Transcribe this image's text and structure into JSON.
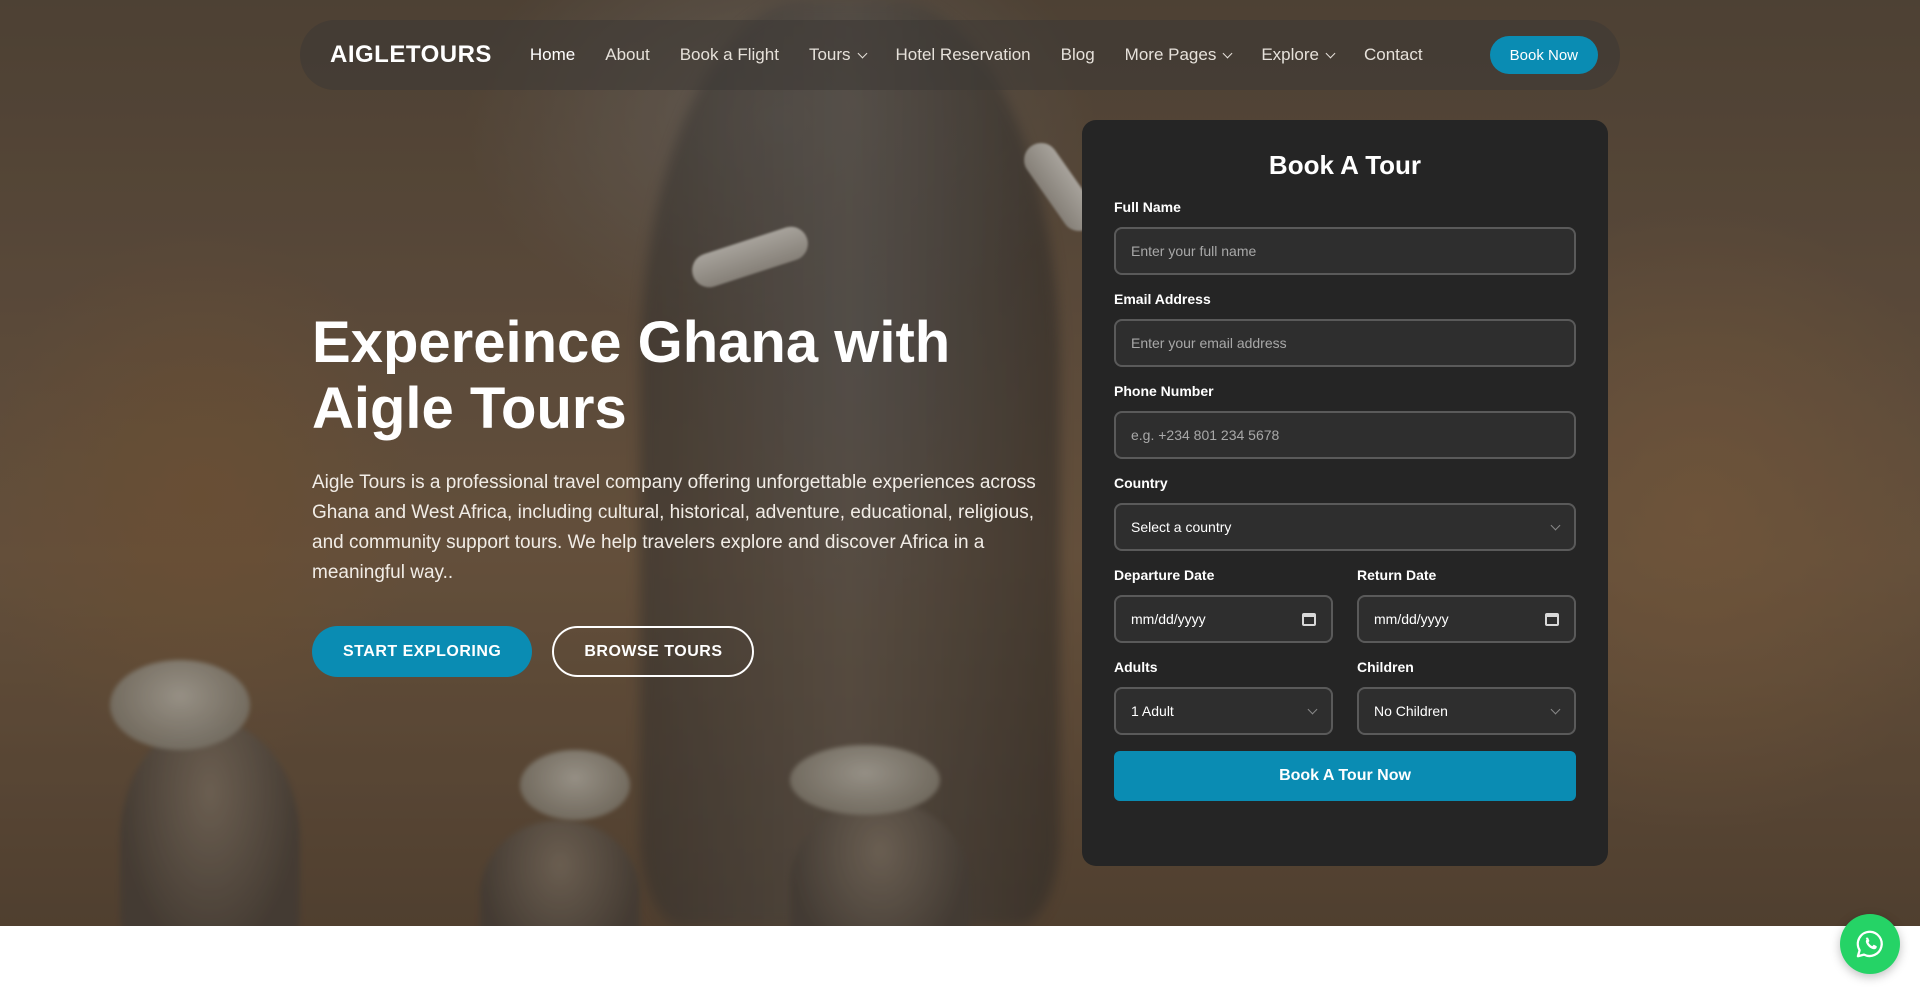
{
  "nav": {
    "brand": "AIGLETOURS",
    "links": [
      {
        "label": "Home",
        "active": true
      },
      {
        "label": "About"
      },
      {
        "label": "Book a Flight"
      },
      {
        "label": "Tours",
        "dropdown": true
      },
      {
        "label": "Hotel Reservation"
      },
      {
        "label": "Blog"
      },
      {
        "label": "More Pages",
        "dropdown": true
      },
      {
        "label": "Explore",
        "dropdown": true
      },
      {
        "label": "Contact"
      }
    ],
    "cta": "Book Now"
  },
  "hero": {
    "title_line1": "Expereince Ghana with",
    "title_line2": "Aigle Tours",
    "description": "Aigle Tours is a professional travel company offering unforgettable experiences across Ghana and West Africa, including cultural, historical, adventure, educational, religious, and community support tours. We help travelers explore and discover Africa in a meaningful way..",
    "primary_button": "START EXPLORING",
    "secondary_button": "BROWSE TOURS"
  },
  "form": {
    "title": "Book A Tour",
    "full_name": {
      "label": "Full Name",
      "placeholder": "Enter your full name"
    },
    "email": {
      "label": "Email Address",
      "placeholder": "Enter your email address"
    },
    "phone": {
      "label": "Phone Number",
      "placeholder": "e.g. +234 801 234 5678"
    },
    "country": {
      "label": "Country",
      "value": "Select a country"
    },
    "departure": {
      "label": "Departure Date",
      "value": "mm/dd/yyyy"
    },
    "return": {
      "label": "Return Date",
      "value": "mm/dd/yyyy"
    },
    "adults": {
      "label": "Adults",
      "value": "1 Adult"
    },
    "children": {
      "label": "Children",
      "value": "No Children"
    },
    "submit": "Book A Tour Now"
  },
  "colors": {
    "accent": "#0a8cb3",
    "card": "#252525",
    "whatsapp": "#25d366"
  },
  "icons": {
    "whatsapp": "whatsapp-icon",
    "calendar": "calendar-icon",
    "chevron": "chevron-down-icon"
  }
}
